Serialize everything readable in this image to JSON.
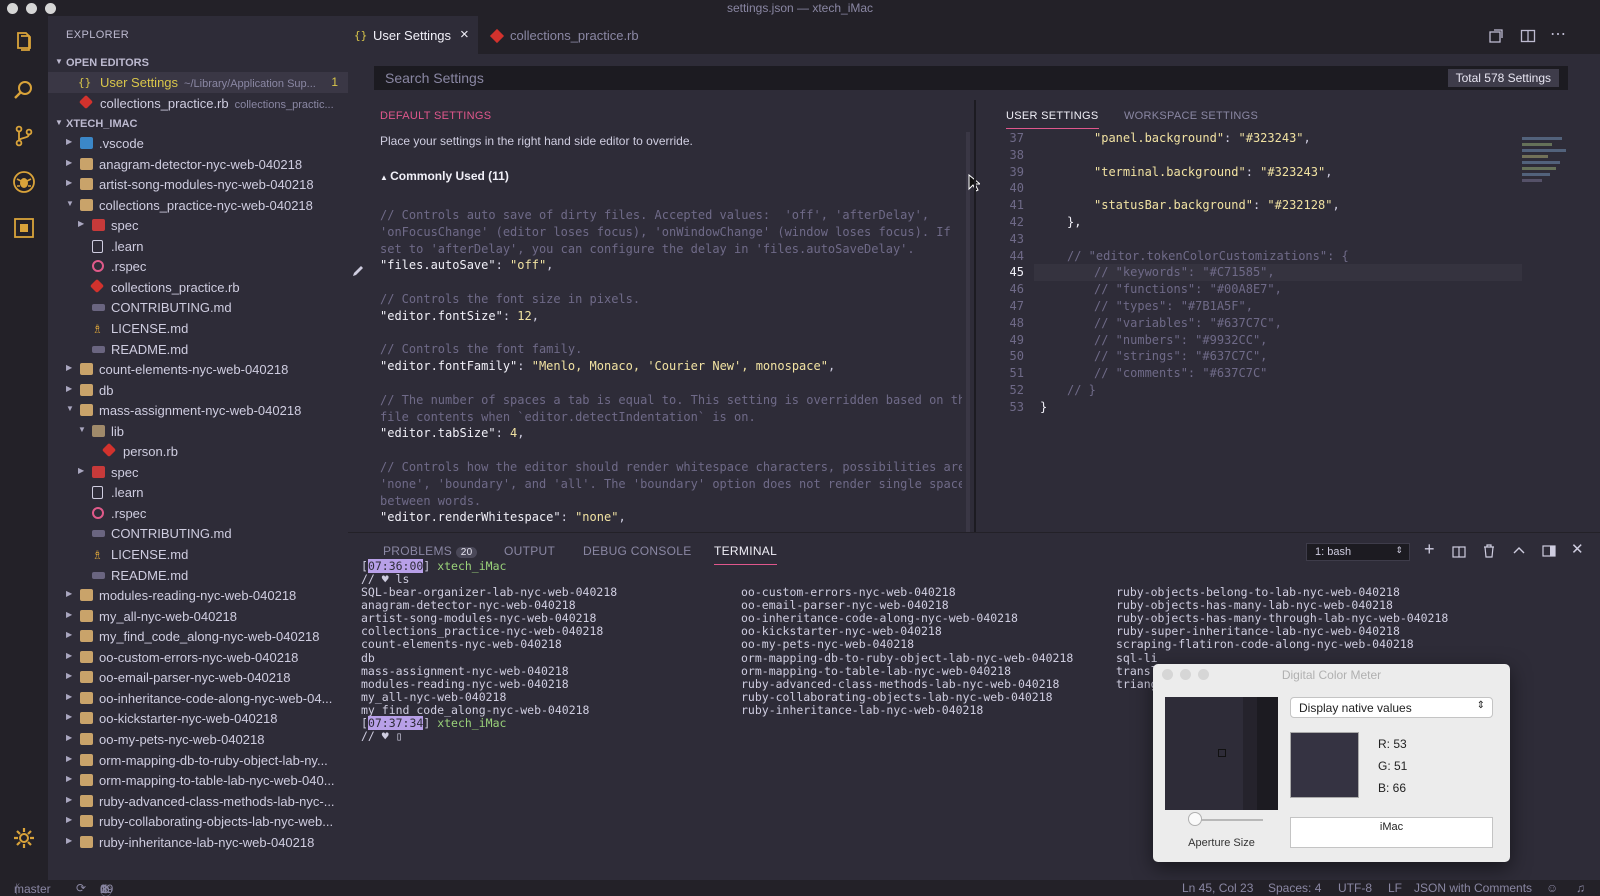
{
  "window": {
    "title": "settings.json — xtech_iMac"
  },
  "sidebar": {
    "header": "EXPLORER",
    "open_editors_label": "OPEN EDITORS",
    "open_editors": [
      {
        "name": "User Settings",
        "detail": "~/Library/Application Sup...",
        "badge": "1",
        "icon": "json-icon"
      },
      {
        "name": "collections_practice.rb",
        "detail": "collections_practic...",
        "icon": "ruby-icon"
      }
    ],
    "workspace_label": "XTECH_IMAC",
    "tree": [
      ".vscode",
      "anagram-detector-nyc-web-040218",
      "artist-song-modules-nyc-web-040218",
      "collections_practice-nyc-web-040218",
      "spec",
      ".learn",
      ".rspec",
      "collections_practice.rb",
      "CONTRIBUTING.md",
      "LICENSE.md",
      "README.md",
      "count-elements-nyc-web-040218",
      "db",
      "mass-assignment-nyc-web-040218",
      "lib",
      "person.rb",
      "spec",
      ".learn",
      ".rspec",
      "CONTRIBUTING.md",
      "LICENSE.md",
      "README.md",
      "modules-reading-nyc-web-040218",
      "my_all-nyc-web-040218",
      "my_find_code_along-nyc-web-040218",
      "oo-custom-errors-nyc-web-040218",
      "oo-email-parser-nyc-web-040218",
      "oo-inheritance-code-along-nyc-web-04...",
      "oo-kickstarter-nyc-web-040218",
      "oo-my-pets-nyc-web-040218",
      "orm-mapping-db-to-ruby-object-lab-ny...",
      "orm-mapping-to-table-lab-nyc-web-040...",
      "ruby-advanced-class-methods-lab-nyc-...",
      "ruby-collaborating-objects-lab-nyc-web...",
      "ruby-inheritance-lab-nyc-web-040218"
    ]
  },
  "tabs": [
    {
      "label": "User Settings",
      "close": "×"
    },
    {
      "label": "collections_practice.rb"
    }
  ],
  "settings": {
    "search_placeholder": "Search Settings",
    "total": "Total 578 Settings",
    "default_title": "DEFAULT SETTINGS",
    "default_hint": "Place your settings in the right hand side editor to override.",
    "group": "Commonly Used (11)",
    "user_tab": "USER SETTINGS",
    "workspace_tab": "WORKSPACE SETTINGS"
  },
  "default_code": [
    {
      "t": "cm",
      "s": "// Controls auto save of dirty files. Accepted values:  'off', 'afterDelay',"
    },
    {
      "t": "cm",
      "s": "'onFocusChange' (editor loses focus), 'onWindowChange' (window loses focus). If"
    },
    {
      "t": "cm",
      "s": "set to 'afterDelay', you can configure the delay in 'files.autoSaveDelay'."
    },
    {
      "t": "kv",
      "k": "\"files.autoSave\"",
      "v": "\"off\""
    },
    {
      "t": "blank",
      "s": ""
    },
    {
      "t": "cm",
      "s": "// Controls the font size in pixels."
    },
    {
      "t": "kv",
      "k": "\"editor.fontSize\"",
      "v": "12"
    },
    {
      "t": "blank",
      "s": ""
    },
    {
      "t": "cm",
      "s": "// Controls the font family."
    },
    {
      "t": "kv",
      "k": "\"editor.fontFamily\"",
      "v": "\"Menlo, Monaco, 'Courier New', monospace\""
    },
    {
      "t": "blank",
      "s": ""
    },
    {
      "t": "cm",
      "s": "// The number of spaces a tab is equal to. This setting is overridden based on the"
    },
    {
      "t": "cm",
      "s": "file contents when `editor.detectIndentation` is on."
    },
    {
      "t": "kv",
      "k": "\"editor.tabSize\"",
      "v": "4"
    },
    {
      "t": "blank",
      "s": ""
    },
    {
      "t": "cm",
      "s": "// Controls how the editor should render whitespace characters, possibilities are"
    },
    {
      "t": "cm",
      "s": "'none', 'boundary', and 'all'. The 'boundary' option does not render single spaces"
    },
    {
      "t": "cm",
      "s": "between words."
    },
    {
      "t": "kv",
      "k": "\"editor.renderWhitespace\"",
      "v": "\"none\""
    }
  ],
  "user_code": [
    {
      "n": "37",
      "t": "kv",
      "k": "\"panel.background\"",
      "v": "\"#323243\"",
      "indent": 2
    },
    {
      "n": "38",
      "t": "blank",
      "s": ""
    },
    {
      "n": "39",
      "t": "kv",
      "k": "\"terminal.background\"",
      "v": "\"#323243\"",
      "indent": 2
    },
    {
      "n": "40",
      "t": "blank",
      "s": ""
    },
    {
      "n": "41",
      "t": "kv",
      "k": "\"statusBar.background\"",
      "v": "\"#232128\"",
      "indent": 2
    },
    {
      "n": "42",
      "t": "plain",
      "s": "},",
      "indent": 1
    },
    {
      "n": "43",
      "t": "blank",
      "s": ""
    },
    {
      "n": "44",
      "t": "cm",
      "s": "// \"editor.tokenColorCustomizations\": {",
      "indent": 1
    },
    {
      "n": "45",
      "t": "cm",
      "s": "// \"keywords\": \"#C71585\",",
      "indent": 2
    },
    {
      "n": "46",
      "t": "cm",
      "s": "// \"functions\": \"#00A8E7\",",
      "indent": 2
    },
    {
      "n": "47",
      "t": "cm",
      "s": "// \"types\": \"#7B1A5F\",",
      "indent": 2
    },
    {
      "n": "48",
      "t": "cm",
      "s": "// \"variables\": \"#637C7C\",",
      "indent": 2
    },
    {
      "n": "49",
      "t": "cm",
      "s": "// \"numbers\": \"#9932CC\",",
      "indent": 2
    },
    {
      "n": "50",
      "t": "cm",
      "s": "// \"strings\": \"#637C7C\",",
      "indent": 2
    },
    {
      "n": "51",
      "t": "cm",
      "s": "// \"comments\": \"#637C7C\"",
      "indent": 2
    },
    {
      "n": "52",
      "t": "cm",
      "s": "// }",
      "indent": 1
    },
    {
      "n": "53",
      "t": "plain",
      "s": "}",
      "indent": 0
    }
  ],
  "panel": {
    "tabs": [
      "PROBLEMS",
      "OUTPUT",
      "DEBUG CONSOLE",
      "TERMINAL"
    ],
    "problems_count": "20",
    "terminal_select": "1: bash",
    "prompt1_time": "07:36:00",
    "prompt2_time": "07:37:34",
    "host": "xtech_iMac",
    "cmd": "// ♥ ls",
    "prompt_tail": "// ♥",
    "ls_col1": [
      "SQL-bear-organizer-lab-nyc-web-040218",
      "anagram-detector-nyc-web-040218",
      "artist-song-modules-nyc-web-040218",
      "collections_practice-nyc-web-040218",
      "count-elements-nyc-web-040218",
      "db",
      "mass-assignment-nyc-web-040218",
      "modules-reading-nyc-web-040218",
      "my_all-nyc-web-040218",
      "my_find_code_along-nyc-web-040218"
    ],
    "ls_col2": [
      "oo-custom-errors-nyc-web-040218",
      "oo-email-parser-nyc-web-040218",
      "oo-inheritance-code-along-nyc-web-040218",
      "oo-kickstarter-nyc-web-040218",
      "oo-my-pets-nyc-web-040218",
      "orm-mapping-db-to-ruby-object-lab-nyc-web-040218",
      "orm-mapping-to-table-lab-nyc-web-040218",
      "ruby-advanced-class-methods-lab-nyc-web-040218",
      "ruby-collaborating-objects-lab-nyc-web-040218",
      "ruby-inheritance-lab-nyc-web-040218"
    ],
    "ls_col3": [
      "ruby-objects-belong-to-lab-nyc-web-040218",
      "ruby-objects-has-many-lab-nyc-web-040218",
      "ruby-objects-has-many-through-lab-nyc-web-040218",
      "ruby-super-inheritance-lab-nyc-web-040218",
      "scraping-flatiron-code-along-nyc-web-040218",
      "sql-li",
      "transl",
      "triang"
    ]
  },
  "color_meter": {
    "title": "Digital Color Meter",
    "mode": "Display native values",
    "r": "R: 53",
    "g": "G: 51",
    "b": "B: 66",
    "swatch": "#353342",
    "aperture": "Aperture Size",
    "display": "iMac"
  },
  "status": {
    "branch": "master",
    "errors": "0",
    "warnings": "1",
    "infos": "19",
    "position": "Ln 45, Col 23",
    "spaces": "Spaces: 4",
    "encoding": "UTF-8",
    "eol": "LF",
    "language": "JSON with Comments"
  },
  "colors": {
    "accent_pink": "#e0578c",
    "activity_bg": "#232128",
    "sidebar_bg": "#2e2c38",
    "editor_bg": "#2e2c38"
  }
}
